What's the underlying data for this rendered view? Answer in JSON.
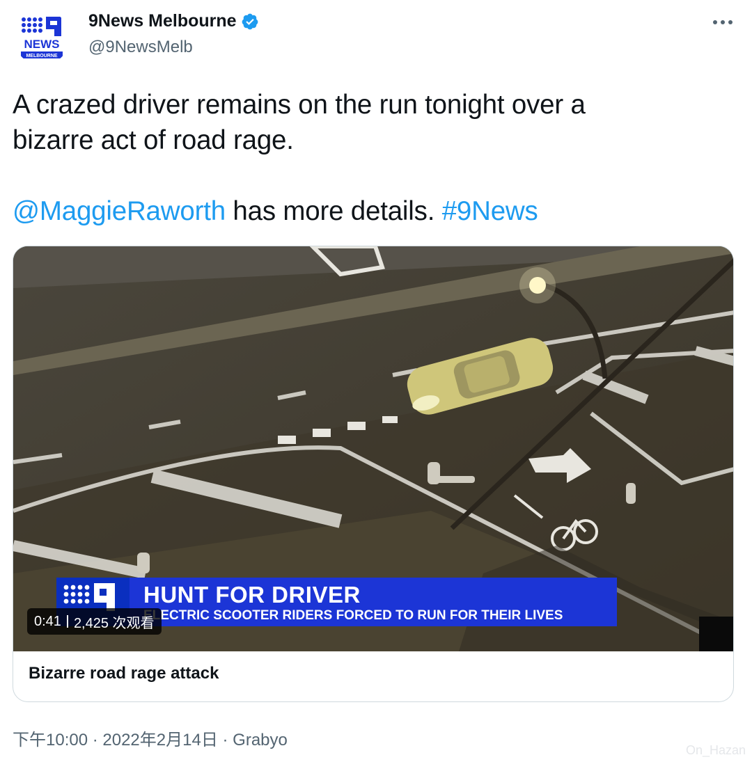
{
  "header": {
    "display_name": "9News Melbourne",
    "handle": "@9NewsMelb",
    "avatar_lines": [
      "NEWS",
      "MELBOURNE"
    ]
  },
  "tweet": {
    "line1": "A crazed driver remains on the run tonight over a",
    "line2": "bizarre act of road rage.",
    "mention": "@MaggieRaworth",
    "middle": " has more details. ",
    "hashtag": "#9News"
  },
  "video": {
    "headline": "HUNT FOR DRIVER",
    "subline": "ELECTRIC SCOOTER RIDERS FORCED TO RUN FOR THEIR LIVES",
    "duration": "0:41",
    "views": "2,425 次观看"
  },
  "card": {
    "title": "Bizarre road rage attack"
  },
  "meta": {
    "time": "下午10:00",
    "date": "2022年2月14日",
    "source": "Grabyo",
    "dot": " · "
  },
  "watermark": "On_Hazan",
  "colors": {
    "link": "#1d9bf0",
    "verified": "#1d9bf0",
    "brand_blue": "#1c35d6"
  },
  "icons": [
    "verified-badge-icon",
    "more-options-icon",
    "nine-news-logo-icon"
  ]
}
